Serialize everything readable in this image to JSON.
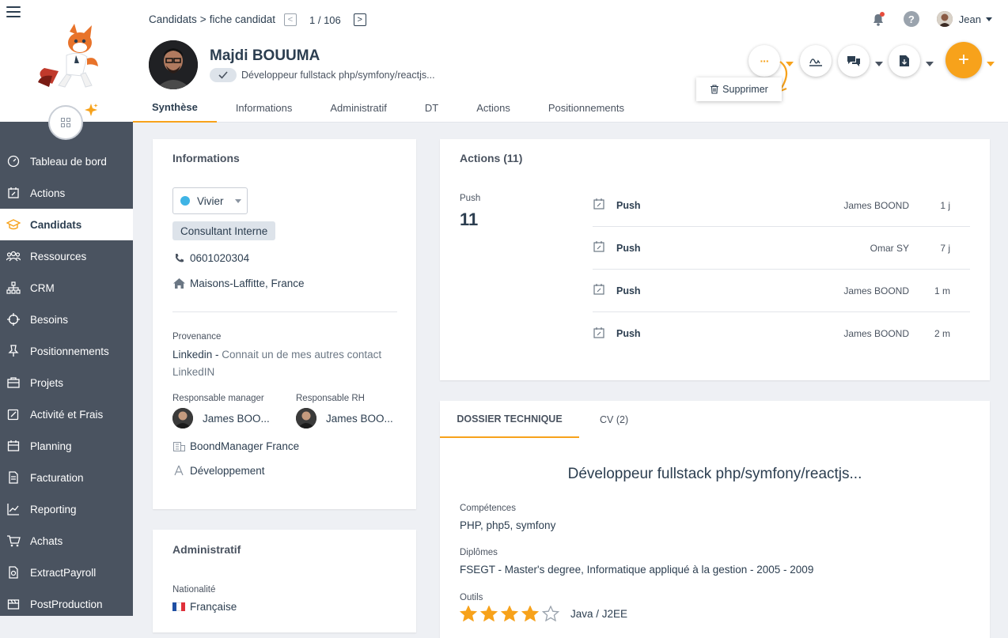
{
  "breadcrumb": {
    "root": "Candidats",
    "sep": ">",
    "current": "fiche candidat"
  },
  "pager": {
    "text": "1 / 106",
    "prev": "<",
    "next": ">"
  },
  "user": {
    "name": "Jean"
  },
  "candidate": {
    "name": "Majdi BOUUMA",
    "title": "Développeur fullstack php/symfony/reactjs..."
  },
  "actions_menu": {
    "more": "···",
    "delete": "Supprimer",
    "add": "+"
  },
  "tabs": [
    "Synthèse",
    "Informations",
    "Administratif",
    "DT",
    "Actions",
    "Positionnements"
  ],
  "sidebar": {
    "items": [
      "Tableau de bord",
      "Actions",
      "Candidats",
      "Ressources",
      "CRM",
      "Besoins",
      "Positionnements",
      "Projets",
      "Activité et Frais",
      "Planning",
      "Facturation",
      "Reporting",
      "Achats",
      "ExtractPayroll",
      "PostProduction"
    ]
  },
  "info_card": {
    "title": "Informations",
    "status": "Vivier",
    "type": "Consultant Interne",
    "phone": "0601020304",
    "location": "Maisons-Laffitte, France",
    "provenance_label": "Provenance",
    "provenance_source": "Linkedin",
    "provenance_dash": " - ",
    "provenance_detail": "Connait un de mes autres contact LinkedIN",
    "manager_label": "Responsable manager",
    "manager_name": "James BOO...",
    "rh_label": "Responsable RH",
    "rh_name": "James BOO...",
    "company": "BoondManager France",
    "pole": "Développement"
  },
  "admin_card": {
    "title": "Administratif",
    "nationality_label": "Nationalité",
    "nationality": "Française"
  },
  "actions_card": {
    "title": "Actions (11)",
    "push_label": "Push",
    "push_count": "11",
    "rows": [
      {
        "type": "Push",
        "who": "James BOOND",
        "age": "1 j"
      },
      {
        "type": "Push",
        "who": "Omar SY",
        "age": "7 j"
      },
      {
        "type": "Push",
        "who": "James BOOND",
        "age": "1 m"
      },
      {
        "type": "Push",
        "who": "James BOOND",
        "age": "2 m"
      }
    ]
  },
  "dossier": {
    "tab1": "DOSSIER TECHNIQUE",
    "tab2": "CV (2)",
    "title": "Développeur fullstack php/symfony/reactjs...",
    "skills_label": "Compétences",
    "skills": "PHP, php5, symfony",
    "diplomas_label": "Diplômes",
    "diplomas": "FSEGT - Master's degree, Informatique appliqué à la gestion - 2005 - 2009",
    "tools_label": "Outils",
    "tool_name": "Java / J2EE",
    "tool_rating": 4,
    "tool_rating_max": 5
  },
  "colors": {
    "accent": "#f7a21b",
    "sidebar": "#4a5360",
    "status_dot": "#3fb4e5"
  }
}
